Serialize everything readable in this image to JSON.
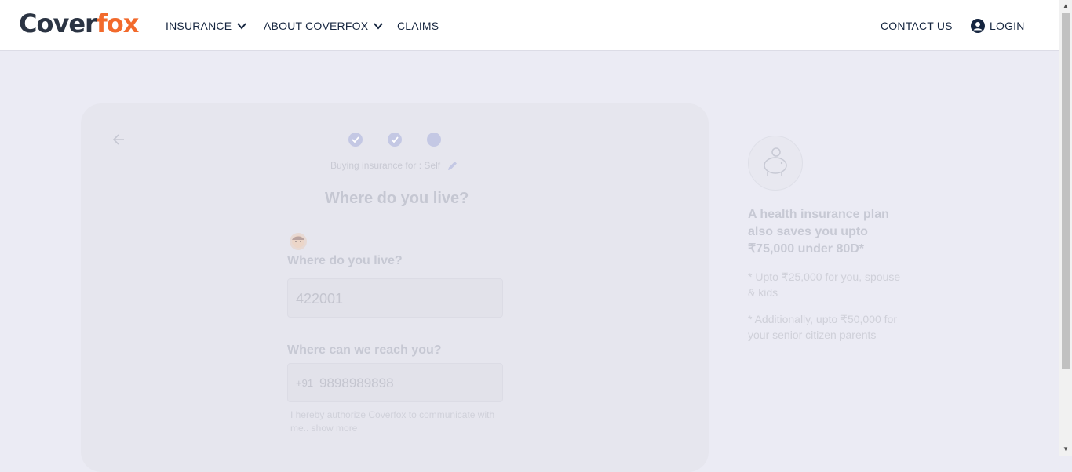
{
  "header": {
    "logo_part1": "Cover",
    "logo_part2": "fox",
    "nav": {
      "insurance": "INSURANCE",
      "about": "ABOUT COVERFOX",
      "claims": "CLAIMS",
      "contact": "CONTACT US",
      "login": "LOGIN"
    }
  },
  "form": {
    "buying_for": "Buying insurance for : Self",
    "title": "Where do you live?",
    "live_label": "Where do you live?",
    "pincode_value": "422001",
    "reach_label": "Where can we reach you?",
    "phone_prefix": "+91",
    "phone_value": "9898989898",
    "consent_text": "I hereby authorize Coverfox to communicate with me.. show more",
    "steps_total": 3,
    "steps_completed": 2
  },
  "side": {
    "headline": "A health insurance plan also saves you upto ₹75,000 under 80D*",
    "note1": "* Upto ₹25,000 for you, spouse & kids",
    "note2": "* Additionally, upto ₹50,000 for your senior citizen parents"
  },
  "colors": {
    "brand_dark": "#2b3443",
    "brand_orange": "#f26a2c",
    "background": "#ebebf4"
  }
}
